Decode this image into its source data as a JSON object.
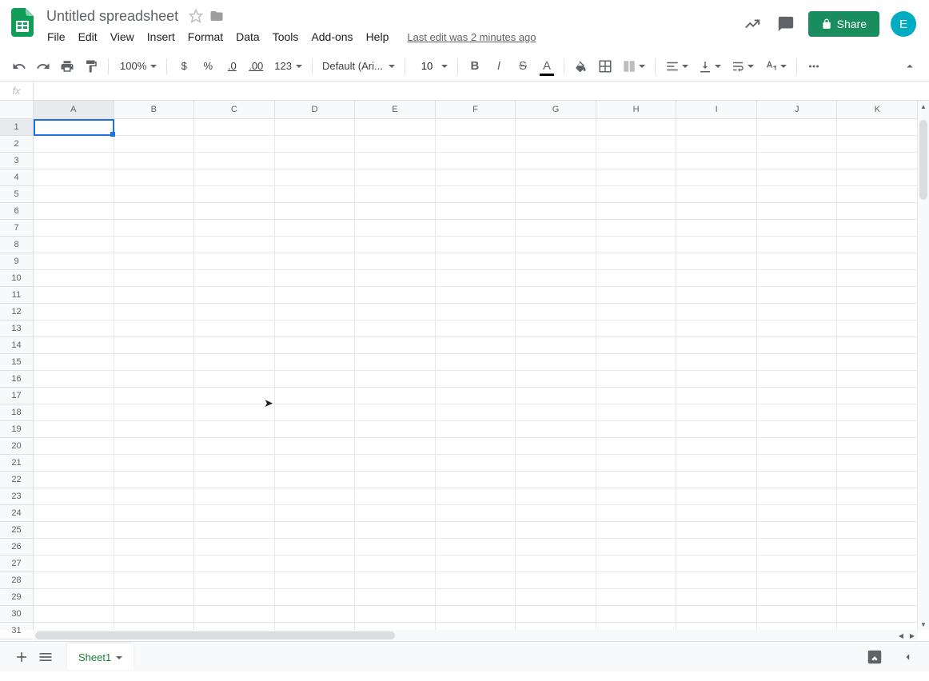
{
  "header": {
    "title": "Untitled spreadsheet",
    "menus": [
      "File",
      "Edit",
      "View",
      "Insert",
      "Format",
      "Data",
      "Tools",
      "Add-ons",
      "Help"
    ],
    "last_edit": "Last edit was 2 minutes ago",
    "share_label": "Share",
    "avatar_letter": "E"
  },
  "toolbar": {
    "zoom": "100%",
    "currency": "$",
    "percent": "%",
    "dec_dec": ".0",
    "inc_dec": ".00",
    "more_fmt": "123",
    "font": "Default (Ari...",
    "font_size": "10"
  },
  "formula": {
    "fx": "fx",
    "value": ""
  },
  "grid": {
    "columns": [
      "A",
      "B",
      "C",
      "D",
      "E",
      "F",
      "G",
      "H",
      "I",
      "J",
      "K"
    ],
    "rows": [
      "1",
      "2",
      "3",
      "4",
      "5",
      "6",
      "7",
      "8",
      "9",
      "10",
      "11",
      "12",
      "13",
      "14",
      "15",
      "16",
      "17",
      "18",
      "19",
      "20",
      "21",
      "22",
      "23",
      "24",
      "25",
      "26",
      "27",
      "28",
      "29",
      "30",
      "31"
    ],
    "active_cell": "A1"
  },
  "sheets": {
    "active": "Sheet1"
  }
}
